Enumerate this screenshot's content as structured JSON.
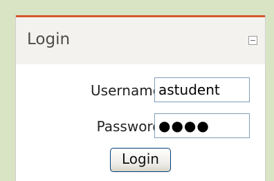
{
  "panel": {
    "title": "Login",
    "collapse_icon": "minus-box-icon"
  },
  "form": {
    "username_label": "Username",
    "username_value": "astudent",
    "password_label": "Password",
    "password_value": "●●●●",
    "login_button": "Login"
  },
  "colors": {
    "background": "#d9e4c4",
    "accent": "#d4562b",
    "header_background": "#f3f2ef"
  }
}
